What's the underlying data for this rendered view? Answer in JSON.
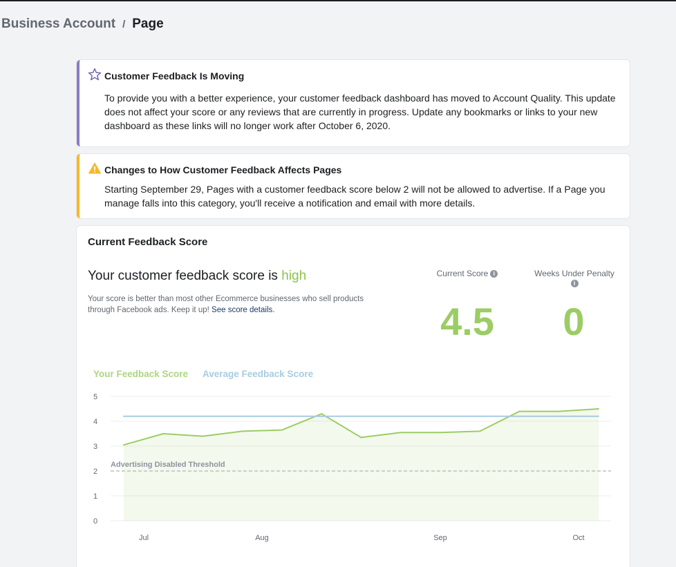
{
  "breadcrumb": {
    "root": "Business Account",
    "separator": "/",
    "current": "Page"
  },
  "notices": [
    {
      "icon": "star-icon",
      "accent": "#8c79c9",
      "title": "Customer Feedback Is Moving",
      "body": "To provide you with a better experience, your customer feedback dashboard has moved to Account Quality. This update does not affect your score or any reviews that are currently in progress. Update any bookmarks or links to your new dashboard as these links will no longer work after October 6, 2020."
    },
    {
      "icon": "warning-icon",
      "accent": "#f7b928",
      "title": "Changes to How Customer Feedback Affects Pages",
      "body": "Starting September 29, Pages with a customer feedback score below 2 will not be allowed to advertise. If a Page you manage falls into this category, you'll receive a notification and email with more details."
    }
  ],
  "score": {
    "card_title": "Current Feedback Score",
    "headline_prefix": "Your customer feedback score is",
    "level": "high",
    "description": "Your score is better than most other Ecommerce businesses who sell products through Facebook ads. Keep it up!",
    "details_link": "See score details.",
    "current_score_label": "Current Score",
    "current_score_value": "4.5",
    "weeks_penalty_label": "Weeks Under Penalty",
    "weeks_penalty_value": "0",
    "accent_color": "#9ccc65"
  },
  "chart_data": {
    "type": "line",
    "title": "",
    "xlabel": "",
    "ylabel": "",
    "ylim": [
      0,
      5
    ],
    "y_ticks": [
      0,
      1,
      2,
      3,
      4,
      5
    ],
    "x_tick_labels": [
      "Jul",
      "Aug",
      "Sep",
      "Oct"
    ],
    "grid": true,
    "legend": "top-left",
    "series": [
      {
        "name": "Your Feedback Score",
        "color": "#9ccc65",
        "fill": true,
        "values": [
          3.05,
          3.5,
          3.4,
          3.6,
          3.65,
          4.3,
          3.35,
          3.55,
          3.55,
          3.6,
          4.4,
          4.4,
          4.5
        ]
      },
      {
        "name": "Average Feedback Score",
        "color": "#a8cbe0",
        "fill": false,
        "values": [
          4.2,
          4.2,
          4.2,
          4.2,
          4.2,
          4.2,
          4.2,
          4.2,
          4.2,
          4.2,
          4.2,
          4.2,
          4.2
        ]
      }
    ],
    "threshold": {
      "label": "Advertising Disabled Threshold",
      "value": 2
    }
  }
}
